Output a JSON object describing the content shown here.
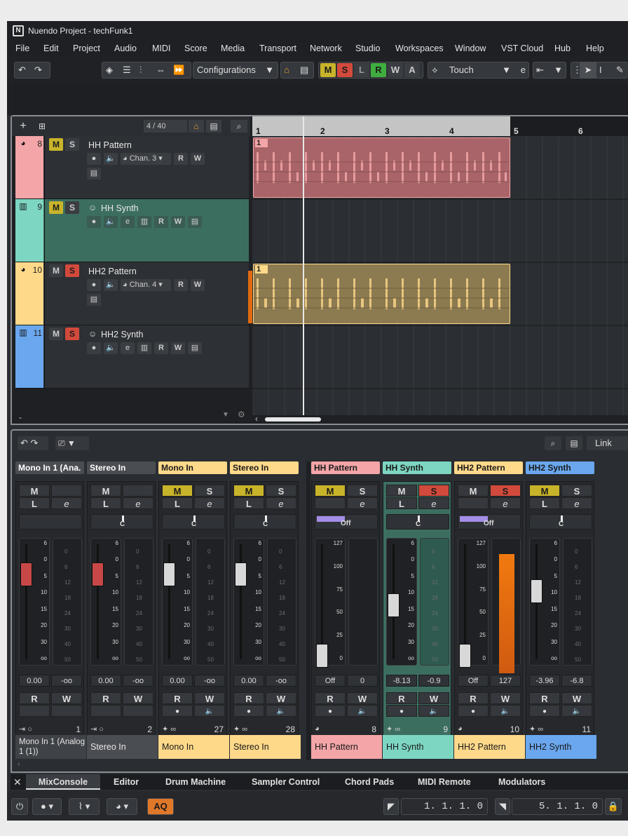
{
  "window": {
    "title": "Nuendo Project - techFunk1"
  },
  "menu": [
    "File",
    "Edit",
    "Project",
    "Audio",
    "MIDI",
    "Score",
    "Media",
    "Transport",
    "Network",
    "Studio",
    "Workspaces",
    "Window",
    "VST Cloud",
    "Hub",
    "Help"
  ],
  "toolbar": {
    "configurations": "Configurations",
    "automation_mode": "Touch",
    "mode_buttons": [
      "M",
      "S",
      "L",
      "R",
      "W",
      "A"
    ],
    "colors": {
      "mute": "#c8b42a",
      "solo": "#d24a3c",
      "read": "#3fae3f",
      "listen": "#3a3d42"
    }
  },
  "project": {
    "track_count": "4 / 40",
    "bottom_label": "-",
    "ruler": [
      "1",
      "2",
      "3",
      "4",
      "5",
      "6"
    ],
    "tracks": [
      {
        "num": "8",
        "name": "HH Pattern",
        "type": "drum-icon",
        "color": "#f3a5a7",
        "channel": "Chan. 3",
        "solo_on": false,
        "bg": "#2d3034"
      },
      {
        "num": "9",
        "name": "HH Synth",
        "type": "piano-icon",
        "color": "#7dd6c2",
        "channel": "",
        "solo_on": false,
        "bg": "#3c6e60"
      },
      {
        "num": "10",
        "name": "HH2 Pattern",
        "type": "drum-icon",
        "color": "#ffd98a",
        "channel": "Chan. 4",
        "solo_on": true,
        "bg": "#2d3034"
      },
      {
        "num": "11",
        "name": "HH2 Synth",
        "type": "piano-icon",
        "color": "#6aa7ee",
        "channel": "",
        "solo_on": true,
        "bg": "#2d3034"
      }
    ],
    "part_label": "1"
  },
  "mixer": {
    "link": "Link",
    "channels": [
      {
        "header": "Mono In 1 (Ana.",
        "name": "Mono In 1 (Analog 1 (1))",
        "num": "1",
        "vol": "0.00",
        "peak": "-oo",
        "color": "#3f4246",
        "text": "#e6e6e6",
        "hdr_color": "#4a4d52",
        "m": false,
        "s": false,
        "pan": "",
        "red_fader": true
      },
      {
        "header": "Stereo In",
        "name": "Stereo In",
        "num": "2",
        "vol": "0.00",
        "peak": "-oo",
        "color": "#4a4d52",
        "text": "#e6e6e6",
        "hdr_color": "#4a4d52",
        "m": false,
        "s": false,
        "pan": "C",
        "red_fader": true
      },
      {
        "header": "Mono In",
        "name": "Mono In",
        "num": "27",
        "vol": "0.00",
        "peak": "-oo",
        "color": "#ffd98a",
        "text": "#1a1a1a",
        "hdr_color": "#ffd98a",
        "m": true,
        "s": false,
        "pan": "C",
        "red_fader": false
      },
      {
        "header": "Stereo In",
        "name": "Stereo In",
        "num": "28",
        "vol": "0.00",
        "peak": "-oo",
        "color": "#ffd98a",
        "text": "#1a1a1a",
        "hdr_color": "#ffd98a",
        "m": true,
        "s": false,
        "pan": "C",
        "red_fader": false
      },
      {
        "header": "HH Pattern",
        "name": "HH Pattern",
        "num": "8",
        "vol": "Off",
        "peak": "0",
        "color": "#f3a5a7",
        "text": "#1a1a1a",
        "hdr_color": "#f3a5a7",
        "m": true,
        "s": false,
        "pan": "Off",
        "red_fader": false
      },
      {
        "header": "HH Synth",
        "name": "HH Synth",
        "num": "9",
        "vol": "-8.13",
        "peak": "-0.9",
        "color": "#7dd6c2",
        "text": "#1a1a1a",
        "hdr_color": "#7dd6c2",
        "m": false,
        "s": true,
        "pan": "C",
        "red_fader": false
      },
      {
        "header": "HH2 Pattern",
        "name": "HH2 Pattern",
        "num": "10",
        "vol": "Off",
        "peak": "127",
        "color": "#ffd98a",
        "text": "#1a1a1a",
        "hdr_color": "#ffd98a",
        "m": false,
        "s": true,
        "pan": "Off",
        "red_fader": false
      },
      {
        "header": "HH2 Synth",
        "name": "HH2 Synth",
        "num": "11",
        "vol": "-3.96",
        "peak": "-6.8",
        "color": "#6aa7ee",
        "text": "#1a1a1a",
        "hdr_color": "#6aa7ee",
        "m": true,
        "s": false,
        "pan": "C",
        "red_fader": false
      }
    ],
    "db_scale": [
      "6",
      "0",
      "5",
      "10",
      "15",
      "20",
      "30",
      "oo"
    ],
    "midi_scale": [
      "127",
      "100",
      "75",
      "50",
      "25",
      "0"
    ],
    "meter_scale": [
      "0",
      "6",
      "12",
      "18",
      "24",
      "30",
      "40",
      "50"
    ]
  },
  "tabs": [
    "MixConsole",
    "Editor",
    "Drum Machine",
    "Sampler Control",
    "Chord Pads",
    "MIDI Remote",
    "Modulators"
  ],
  "status": {
    "aq": "AQ",
    "left_locator": "1. 1. 1.  0",
    "right_locator": "5. 1. 1.  0"
  }
}
